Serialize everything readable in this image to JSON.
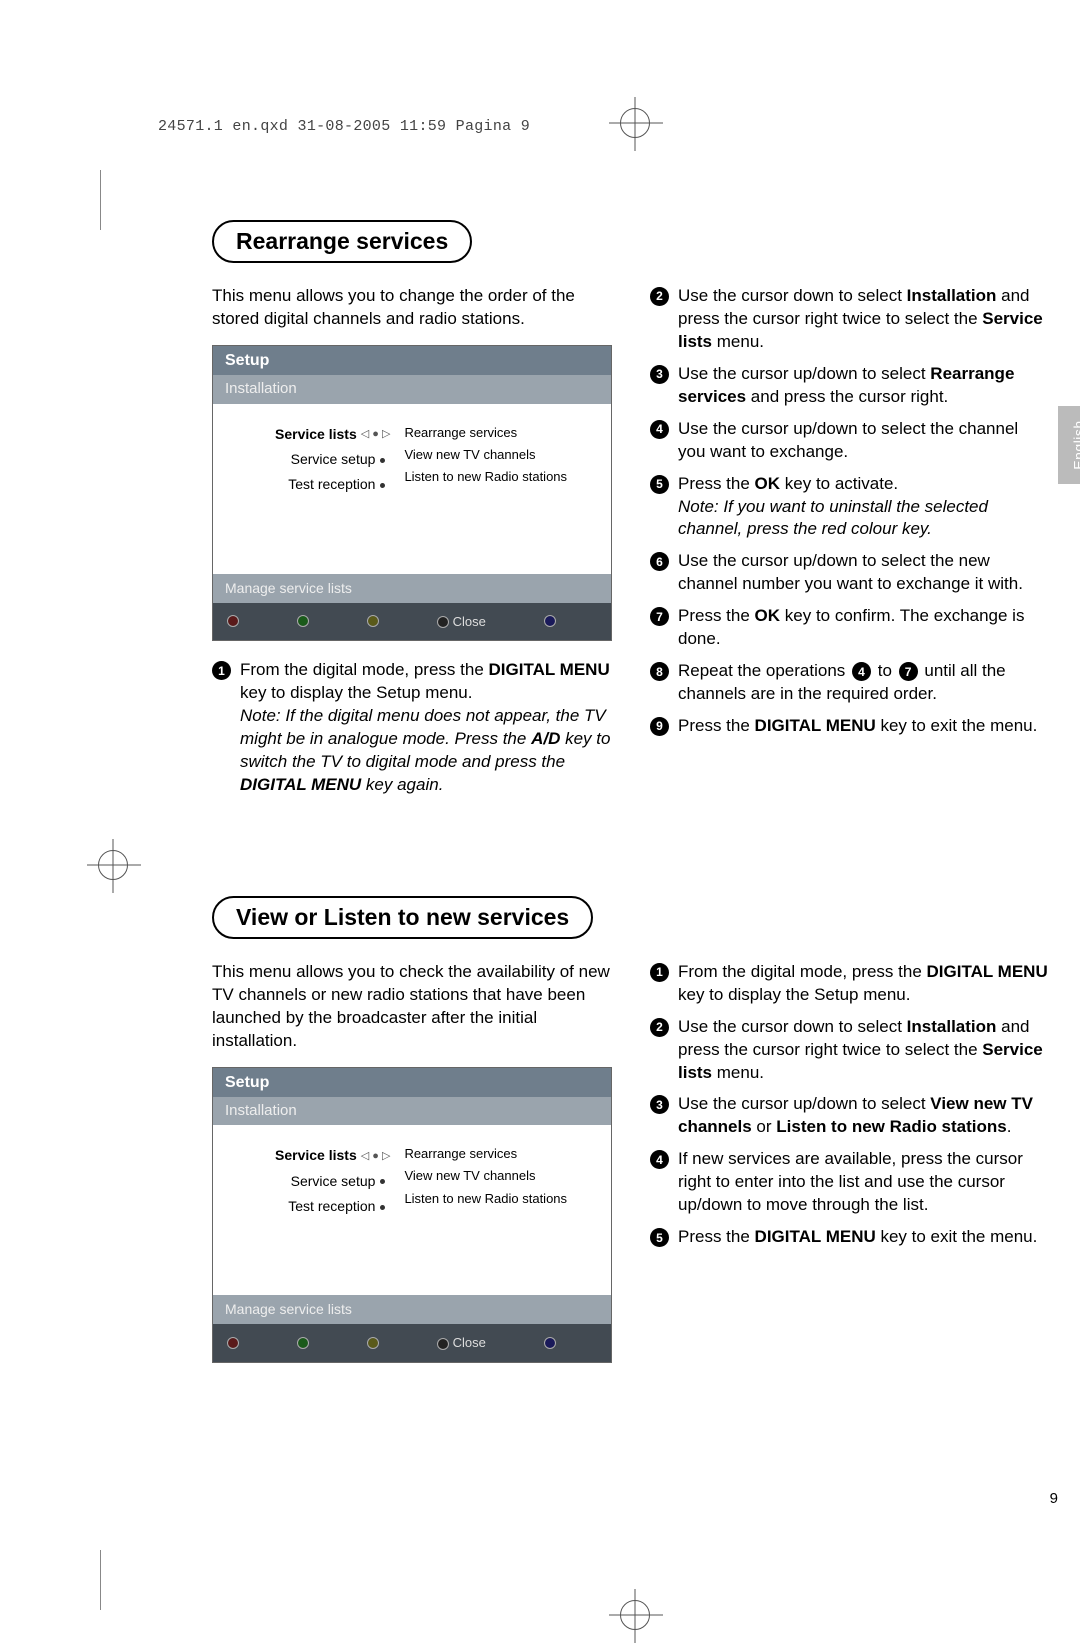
{
  "header_line": "24571.1 en.qxd  31-08-2005  11:59  Pagina 9",
  "language_tab": "English",
  "page_number": "9",
  "section1": {
    "title": "Rearrange services",
    "intro": "This menu allows you to change the order of the stored digital channels and radio stations.",
    "osd": {
      "title": "Setup",
      "subtitle": "Installation",
      "left": {
        "item1": "Service lists",
        "item2": "Service setup",
        "item3": "Test reception"
      },
      "right": {
        "item1": "Rearrange services",
        "item2": "View new TV channels",
        "item3": "Listen to new Radio stations"
      },
      "hint": "Manage service lists",
      "close": "Close"
    },
    "left_steps": [
      {
        "n": "1",
        "pre": "From the digital mode, press the ",
        "b1": "DIGITAL MENU",
        "post": " key to display the Setup menu.",
        "note_pre": "Note: If the digital menu does not appear, the TV might be in analogue mode. Press the ",
        "note_b": "A/D",
        "note_mid": " key to switch the TV to digital mode and press the ",
        "note_b2": "DIGITAL MENU",
        "note_post": " key again."
      }
    ],
    "right_steps": [
      {
        "n": "2",
        "pre": "Use the cursor down to select ",
        "b1": "Installation",
        "mid": " and press the cursor right twice to select the ",
        "b2": "Service lists",
        "post": " menu."
      },
      {
        "n": "3",
        "pre": "Use the cursor up/down to select ",
        "b1": "Rearrange services",
        "post": " and press the cursor right."
      },
      {
        "n": "4",
        "text": "Use the cursor up/down to select the channel you want to exchange."
      },
      {
        "n": "5",
        "pre": "Press the ",
        "b1": "OK",
        "post": " key to activate.",
        "note": "Note: If you want to uninstall the selected channel, press the red colour key."
      },
      {
        "n": "6",
        "text": "Use the cursor up/down to select the new channel number you want to exchange it with."
      },
      {
        "n": "7",
        "pre": "Press the ",
        "b1": "OK",
        "post": " key to confirm. The exchange is done."
      },
      {
        "n": "8",
        "pre": "Repeat the operations ",
        "mid": " to ",
        "post": " until all the channels are in the required order.",
        "mark_a": "4",
        "mark_b": "7"
      },
      {
        "n": "9",
        "pre": "Press the ",
        "b1": "DIGITAL MENU",
        "post": " key to exit the menu."
      }
    ]
  },
  "section2": {
    "title": "View or Listen to new services",
    "intro": "This menu allows you to check the availability of new TV channels or new radio stations that have been launched by the broadcaster after the initial installation.",
    "osd": {
      "title": "Setup",
      "subtitle": "Installation",
      "left": {
        "item1": "Service lists",
        "item2": "Service setup",
        "item3": "Test reception"
      },
      "right": {
        "item1": "Rearrange services",
        "item2": "View new TV channels",
        "item3": "Listen to new Radio stations"
      },
      "hint": "Manage service lists",
      "close": "Close"
    },
    "right_steps": [
      {
        "n": "1",
        "pre": "From the digital mode, press the ",
        "b1": "DIGITAL MENU",
        "post": " key to display the Setup menu."
      },
      {
        "n": "2",
        "pre": "Use the cursor down to select ",
        "b1": "Installation",
        "mid": " and press the cursor right twice to select the ",
        "b2": "Service lists",
        "post": " menu."
      },
      {
        "n": "3",
        "pre": "Use the cursor up/down to select ",
        "b1": "View new TV channels",
        "mid": " or ",
        "b2": "Listen to new Radio stations",
        "post": "."
      },
      {
        "n": "4",
        "text": "If new services are available, press the cursor right to enter into the list and use the cursor up/down to move through the list."
      },
      {
        "n": "5",
        "pre": "Press the ",
        "b1": "DIGITAL MENU",
        "post": " key to exit the menu."
      }
    ]
  }
}
